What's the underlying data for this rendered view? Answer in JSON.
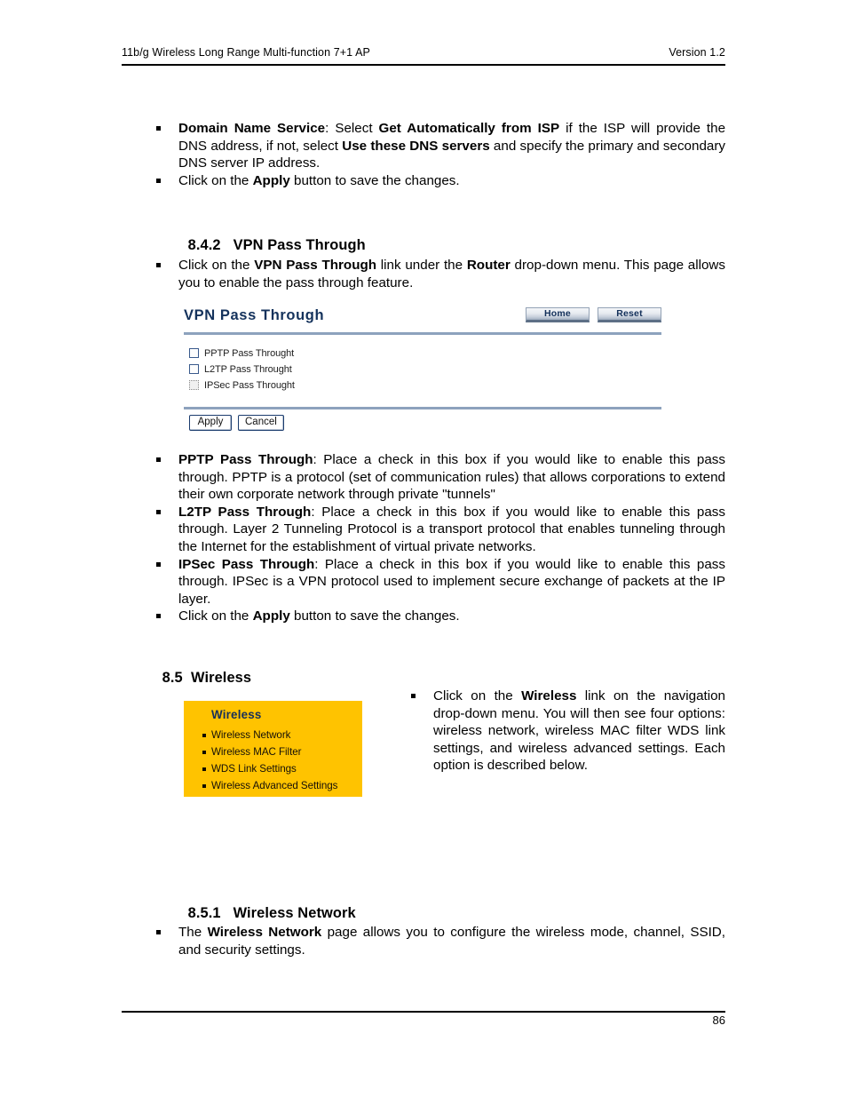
{
  "header": {
    "left": "11b/g Wireless Long Range Multi-function 7+1 AP",
    "right": "Version 1.2"
  },
  "footer": {
    "page_number": "86"
  },
  "colors": {
    "ui_title": "#14325c",
    "ui_rule": "#8da2bd",
    "menu_background": "#FFC300",
    "menu_title": "#16305a"
  },
  "intro_bullets": {
    "dns": {
      "term": "Domain Name Service",
      "t1": ": Select ",
      "b1": "Get Automatically from ISP",
      "t2": " if the ISP will provide the DNS address, if not, select ",
      "b2": "Use these DNS servers",
      "t3": " and specify the primary and secondary DNS server IP address."
    },
    "apply": {
      "t1": "Click on the ",
      "b1": "Apply",
      "t2": " button to save the changes."
    }
  },
  "section_842": {
    "number": "8.4.2",
    "title": "VPN Pass Through",
    "intro": {
      "t1": "Click on the ",
      "b1": "VPN Pass Through",
      "t2": " link under the ",
      "b2": "Router",
      "t3": " drop-down menu. This page allows you to enable the pass through feature."
    }
  },
  "vpn_panel": {
    "title": "VPN Pass Through",
    "home_button": "Home",
    "reset_button": "Reset",
    "checkboxes": [
      {
        "label": "PPTP Pass Throught",
        "checked": false,
        "focused": false
      },
      {
        "label": "L2TP Pass Throught",
        "checked": false,
        "focused": false
      },
      {
        "label": "IPSec Pass Throught",
        "checked": false,
        "focused": true
      }
    ],
    "apply_button": "Apply",
    "cancel_button": "Cancel"
  },
  "pass_through_bullets": {
    "pptp": {
      "term": "PPTP Pass Through",
      "text": ": Place a check in this box if you would like to enable this pass through. PPTP is a protocol (set of communication rules) that allows corporations to extend their own corporate network through private \"tunnels\""
    },
    "l2tp": {
      "term": "L2TP Pass Through",
      "text": ": Place a check in this box if you would like to enable this pass through. Layer 2 Tunneling Protocol is a transport protocol that enables tunneling through the Internet for the establishment of virtual private networks."
    },
    "ipsec": {
      "term": "IPSec Pass Through",
      "text": ": Place a check in this box if you would like to enable this pass through. IPSec is a VPN protocol used to implement secure exchange of packets at the IP layer."
    },
    "apply": {
      "t1": "Click on the ",
      "b1": "Apply",
      "t2": " button to save the changes."
    }
  },
  "section_85": {
    "number": "8.5",
    "title": "Wireless"
  },
  "wireless_menu": {
    "title": "Wireless",
    "items": [
      {
        "label": "Wireless Network"
      },
      {
        "label": "Wireless MAC Filter"
      },
      {
        "label": "WDS Link Settings"
      },
      {
        "label": "Wireless Advanced Settings"
      }
    ]
  },
  "wireless_note": {
    "t1": "Click on the ",
    "b1": "Wireless",
    "t2": " link on the navigation drop-down menu. You will then see four options: wireless network, wireless MAC filter WDS link settings, and wireless advanced settings. Each option is described below."
  },
  "section_851": {
    "number": "8.5.1",
    "title": "Wireless Network",
    "intro": {
      "t1": "The ",
      "b1": "Wireless Network",
      "t2": " page allows you to configure the wireless mode, channel, SSID, and security settings."
    }
  }
}
